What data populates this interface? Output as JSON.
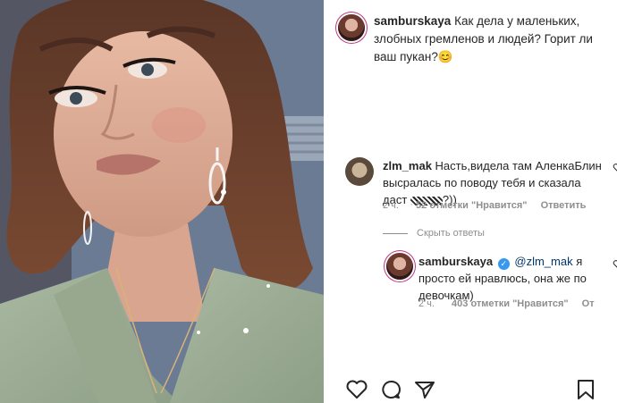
{
  "post": {
    "author": "samburskaya",
    "caption": "Как дела у маленьких, злобных гремленов и людей? Горит ли ваш пукан?",
    "caption_emoji": "😊"
  },
  "comments": [
    {
      "user": "zlm_mak",
      "text_before": "Насть,видела там АленкаБлин высралась по поводу тебя и сказала даст",
      "text_after": "?))",
      "time": "2 ч.",
      "likes": "52 отметки \"Нравится\"",
      "reply": "Ответить"
    }
  ],
  "hide_replies": "Скрыть ответы",
  "reply": {
    "user": "samburskaya",
    "mention": "@zlm_mak",
    "text": "я просто ей нравлюсь, она же по девочкам)",
    "time": "2 ч.",
    "likes": "403 отметки \"Нравится\"",
    "reply_cut": "От"
  },
  "icons": [
    "heart-icon",
    "comment-icon",
    "share-icon",
    "bookmark-icon",
    "verified-icon",
    "more-icon"
  ],
  "colors": {
    "link": "#00376b",
    "muted": "#8e8e8e",
    "verified": "#3897f0"
  }
}
